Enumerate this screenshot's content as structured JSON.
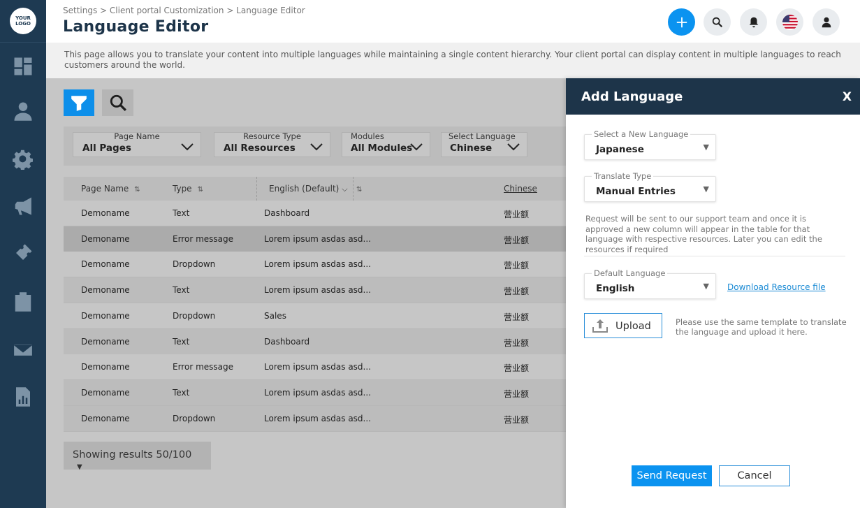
{
  "logo": {
    "text": "YOUR\nLOGO"
  },
  "sidebar": {
    "items": [
      {
        "icon": "dashboard-icon"
      },
      {
        "icon": "user-icon"
      },
      {
        "icon": "gear-icon"
      },
      {
        "icon": "megaphone-icon"
      },
      {
        "icon": "ticket-icon"
      },
      {
        "icon": "clipboard-check-icon"
      },
      {
        "icon": "mail-icon"
      },
      {
        "icon": "report-icon"
      }
    ]
  },
  "header": {
    "breadcrumb": "Settings >  Client portal Customization > Language Editor",
    "title": "Language Editor"
  },
  "description": "This page allows you to translate your content into multiple languages while maintaining a single content hierarchy. Your client portal can display content in multiple languages to reach customers around the world.",
  "filters": [
    {
      "label": "Page Name",
      "value": "All Pages"
    },
    {
      "label": "Resource Type",
      "value": "All Resources"
    },
    {
      "label": "Modules",
      "value": "All Modules"
    },
    {
      "label": "Select Language",
      "value": "Chinese"
    }
  ],
  "table": {
    "columns": [
      "Page Name",
      "Type",
      "English (Default)",
      "Chinese"
    ],
    "rows": [
      [
        "Demoname",
        "Text",
        "Dashboard",
        "营业额"
      ],
      [
        "Demoname",
        "Error message",
        "Lorem ipsum asdas asd...",
        "营业额"
      ],
      [
        "Demoname",
        "Dropdown",
        "Lorem ipsum asdas asd...",
        "营业额"
      ],
      [
        "Demoname",
        "Text",
        "Lorem ipsum asdas asd...",
        "营业额"
      ],
      [
        "Demoname",
        "Dropdown",
        "Sales",
        "营业额"
      ],
      [
        "Demoname",
        "Text",
        "Dashboard",
        "营业额"
      ],
      [
        "Demoname",
        "Error message",
        "Lorem ipsum asdas asd...",
        "营业额"
      ],
      [
        "Demoname",
        "Text",
        "Lorem ipsum asdas asd...",
        "营业额"
      ],
      [
        "Demoname",
        "Dropdown",
        "Lorem ipsum asdas asd...",
        "营业额"
      ]
    ]
  },
  "results": {
    "label": "Showing results 50/100",
    "caret": "▼"
  },
  "panel": {
    "title": "Add Language",
    "close": "X",
    "new_language": {
      "label": "Select a New Language",
      "value": "Japanese"
    },
    "translate_type": {
      "label": "Translate Type",
      "value": "Manual Entries"
    },
    "note": "Request will be sent to our support team and once it is approved a new column will appear in the table for that language with respective resources. Later you can edit the resources if required",
    "default_language": {
      "label": "Default Language",
      "value": "English"
    },
    "download_link": "Download Resource file",
    "upload_label": "Upload",
    "upload_note": "Please use the same template to translate the language and upload it here.",
    "send_label": "Send Request",
    "cancel_label": "Cancel"
  },
  "colors": {
    "accent": "#0b93f0",
    "sidebar": "#1e3a52",
    "panel_header": "#1d3449"
  }
}
